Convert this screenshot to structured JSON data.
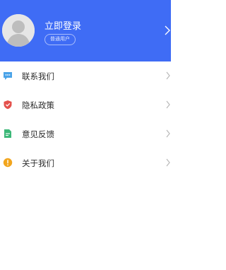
{
  "header": {
    "login_title": "立即登录",
    "user_badge": "普通用户",
    "background_color": "#3f6cf5"
  },
  "menu": {
    "items": [
      {
        "label": "联系我们",
        "icon": "chat-bubble-icon",
        "icon_color": "#4aa3e8"
      },
      {
        "label": "隐私政策",
        "icon": "shield-icon",
        "icon_color": "#e4514c"
      },
      {
        "label": "意见反馈",
        "icon": "document-icon",
        "icon_color": "#3cb878"
      },
      {
        "label": "关于我们",
        "icon": "info-icon",
        "icon_color": "#f2a51d"
      }
    ]
  }
}
